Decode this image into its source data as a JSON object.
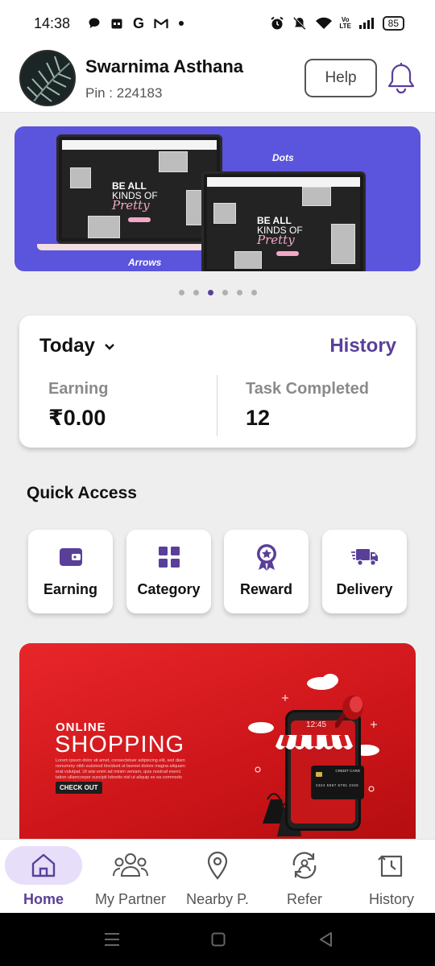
{
  "status_bar": {
    "time": "14:38",
    "battery": "85",
    "notification_icons": [
      "chat-bubble-icon",
      "calendar-icon",
      "google-icon",
      "gmail-icon",
      "dot-icon"
    ],
    "system_icons": [
      "alarm-icon",
      "mute-icon",
      "wifi-icon",
      "volte-icon",
      "signal-icon",
      "battery-icon"
    ],
    "volte_label": "Vo LTE"
  },
  "header": {
    "user_name": "Swarnima Asthana",
    "pin": "Pin : 224183",
    "help_label": "Help"
  },
  "banner": {
    "label_dots": "Dots",
    "label_arrows": "Arrows",
    "promo_line1": "BE ALL",
    "promo_line2": "KINDS OF",
    "promo_script": "Pretty",
    "slide_count": 6,
    "active_slide": 3
  },
  "stats": {
    "period": "Today",
    "history_label": "History",
    "earning_label": "Earning",
    "earning_value": "₹0.00",
    "tasks_label": "Task Completed",
    "tasks_value": "12"
  },
  "quick_access": {
    "title": "Quick Access",
    "items": [
      {
        "label": "Earning",
        "icon": "wallet-icon"
      },
      {
        "label": "Category",
        "icon": "grid-icon"
      },
      {
        "label": "Reward",
        "icon": "award-icon"
      },
      {
        "label": "Delivery",
        "icon": "truck-icon"
      }
    ]
  },
  "promo": {
    "online": "ONLINE",
    "shopping": "SHOPPING",
    "description": "Lorem ipsum dolor sit amet, consectetuer adipiscing elit, sed diam nonummy nibh euismod tincidunt ut laoreet dolore magna aliquam erat volutpat. Ut wisi enim ad minim veniam, quis nostrud exerci tation ullamcorper suscipit lobortis nisl ut aliquip ex ea commodo consequat.",
    "cta": "CHECK OUT",
    "phone_time": "12:45",
    "card_title": "CREDIT CARD",
    "card_number": "2324 5567 6781 2345"
  },
  "bottom_nav": {
    "items": [
      {
        "label": "Home",
        "icon": "home-icon",
        "active": true
      },
      {
        "label": "My Partner",
        "icon": "partners-icon",
        "active": false
      },
      {
        "label": "Nearby P.",
        "icon": "location-pin-icon",
        "active": false
      },
      {
        "label": "Refer",
        "icon": "refer-icon",
        "active": false
      },
      {
        "label": "History",
        "icon": "history-icon",
        "active": false
      }
    ]
  },
  "colors": {
    "accent": "#5a3f99",
    "banner_bg": "#5b54dc",
    "promo_bg": "#d8181c",
    "active_pill": "#e7defa"
  }
}
